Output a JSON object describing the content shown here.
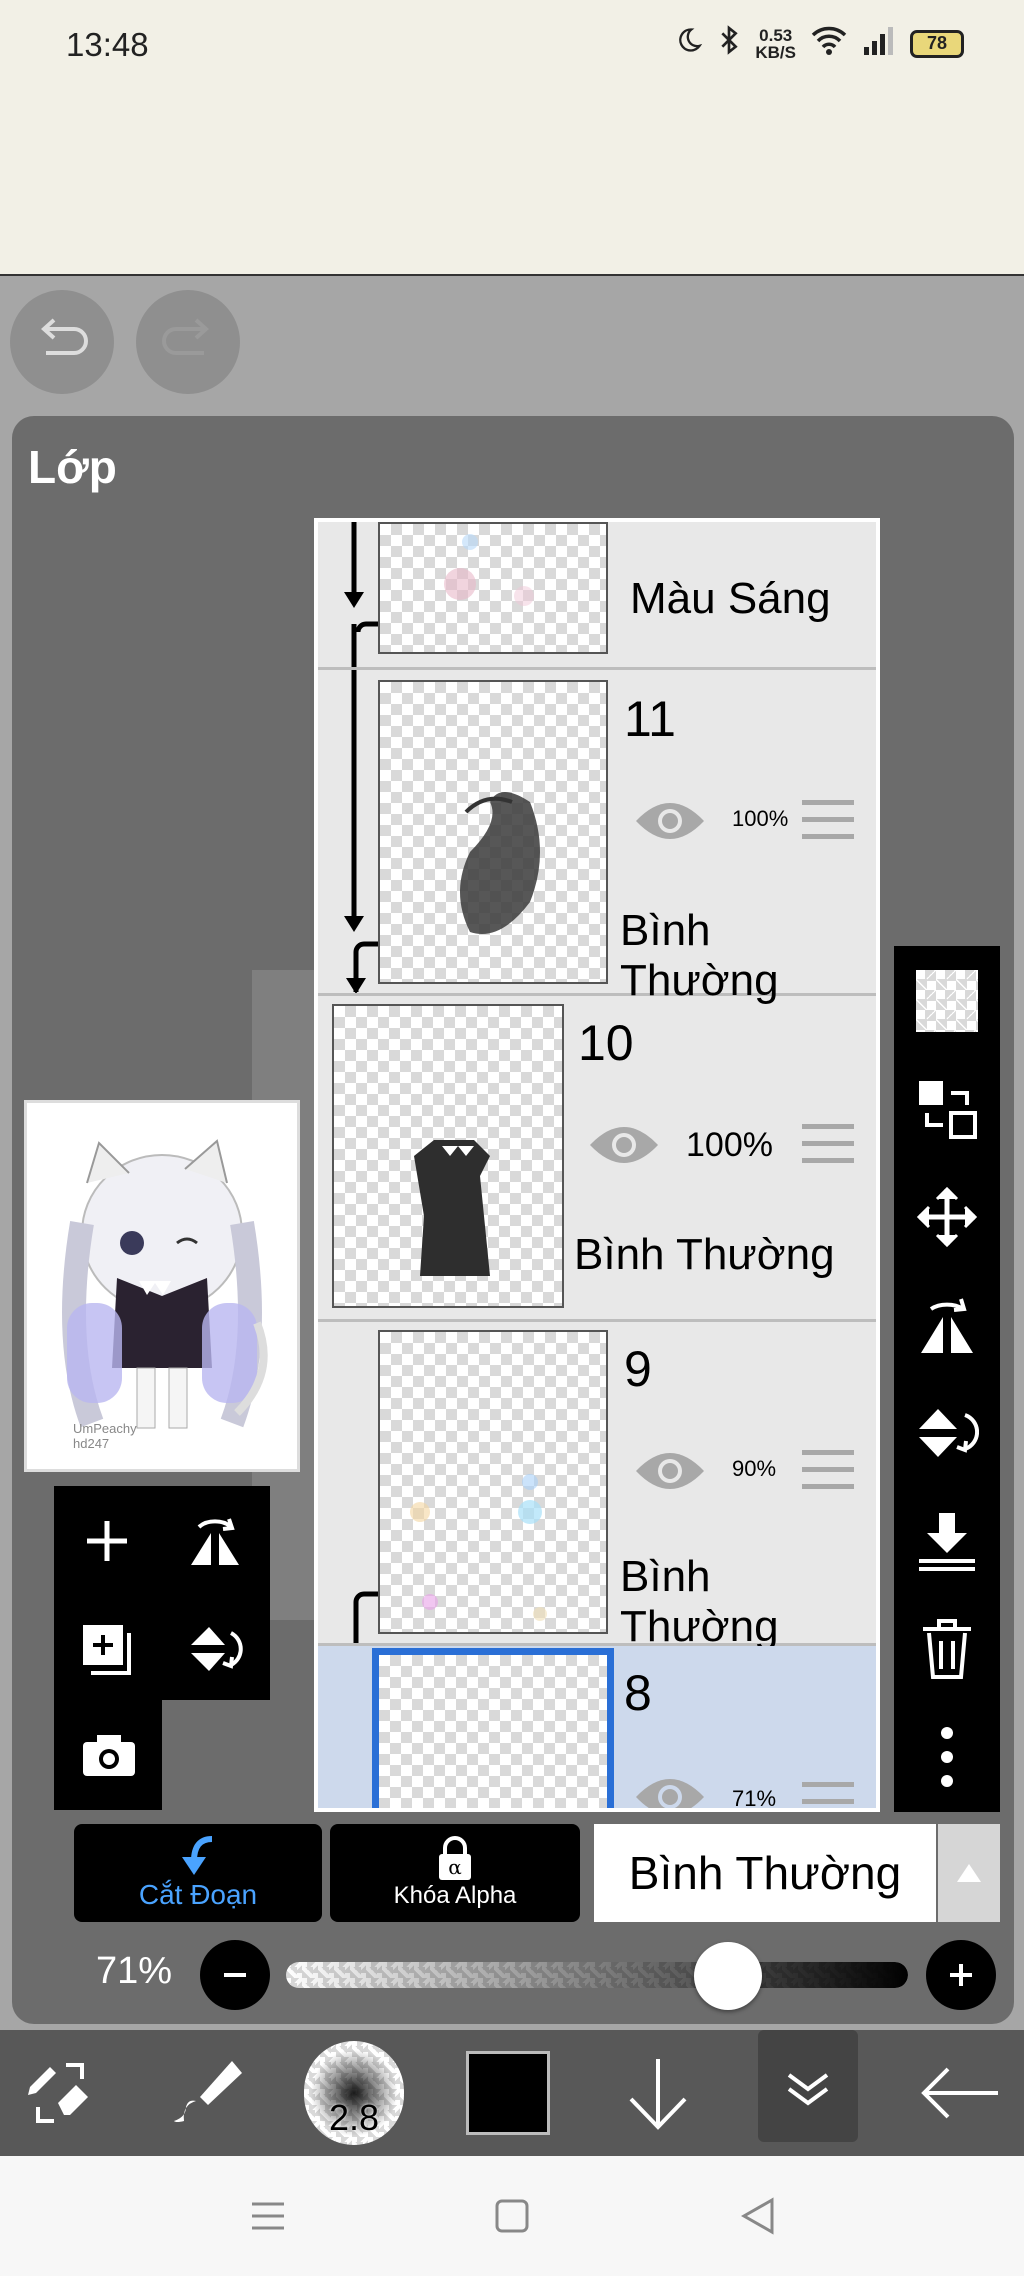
{
  "status_bar": {
    "time": "13:48",
    "net_speed_value": "0.53",
    "net_speed_unit": "KB/S",
    "battery": "78"
  },
  "layers_panel": {
    "title": "Lớp",
    "layers": [
      {
        "number": "",
        "blend": "Màu Sáng"
      },
      {
        "number": "11",
        "opacity": "100%",
        "blend": "Bình Thường"
      },
      {
        "number": "10",
        "opacity": "100%",
        "blend": "Bình Thường"
      },
      {
        "number": "9",
        "opacity": "90%",
        "blend": "Bình Thường"
      },
      {
        "number": "8",
        "opacity": "71%",
        "selected": true
      }
    ]
  },
  "preview": {
    "watermark": "UmPeachy\nhd247"
  },
  "layer_controls": {
    "clip_label": "Cắt Đoạn",
    "alpha_lock_label": "Khóa Alpha",
    "blend_mode": "Bình Thường",
    "opacity_label": "71%",
    "opacity_value": 0.71
  },
  "brush": {
    "size": "2.8",
    "color": "#000000"
  },
  "colors": {
    "accent": "#4aa3ff",
    "selected_layer": "#cdd9ec",
    "selected_border": "#2a6fd6"
  }
}
